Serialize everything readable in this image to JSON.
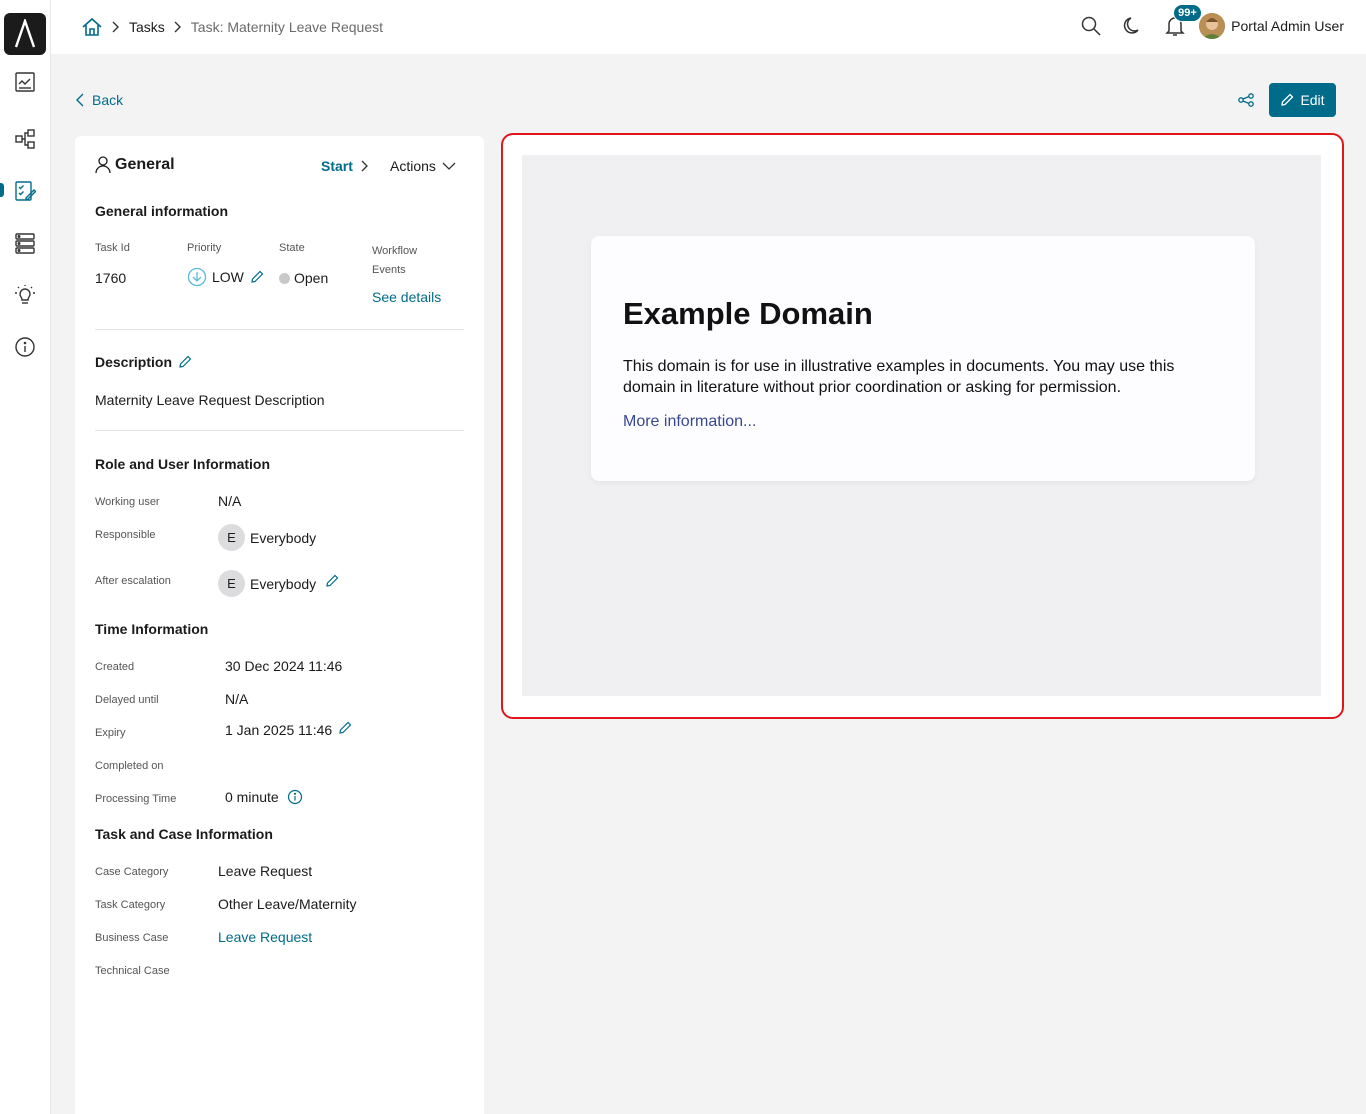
{
  "breadcrumb": {
    "items": [
      "Tasks",
      "Task: Maternity Leave Request"
    ]
  },
  "header": {
    "notification_count": "99+",
    "user_name": "Portal Admin User"
  },
  "toolbar": {
    "back_label": "Back",
    "edit_label": "Edit"
  },
  "general": {
    "title": "General",
    "start_label": "Start",
    "actions_label": "Actions",
    "info_title": "General information",
    "task_id_label": "Task Id",
    "task_id": "1760",
    "priority_label": "Priority",
    "priority": "LOW",
    "state_label": "State",
    "state": "Open",
    "workflow_label": "Workflow Events",
    "see_details": "See details"
  },
  "description": {
    "title": "Description",
    "text": "Maternity Leave Request Description"
  },
  "roles": {
    "title": "Role and User Information",
    "working_user_label": "Working user",
    "working_user": "N/A",
    "responsible_label": "Responsible",
    "responsible_initial": "E",
    "responsible": "Everybody",
    "after_escalation_label": "After escalation",
    "after_escalation_initial": "E",
    "after_escalation": "Everybody"
  },
  "time": {
    "title": "Time Information",
    "created_label": "Created",
    "created": "30 Dec 2024 11:46",
    "delayed_label": "Delayed until",
    "delayed": "N/A",
    "expiry_label": "Expiry",
    "expiry": "1 Jan 2025 11:46",
    "completed_label": "Completed on",
    "processing_label": "Processing Time",
    "processing": "0 minute"
  },
  "case": {
    "title": "Task and Case Information",
    "case_category_label": "Case Category",
    "case_category": "Leave Request",
    "task_category_label": "Task Category",
    "task_category": "Other Leave/Maternity",
    "business_case_label": "Business Case",
    "business_case": "Leave Request",
    "technical_case_label": "Technical Case"
  },
  "embedded": {
    "title": "Example Domain",
    "text": "This domain is for use in illustrative examples in documents. You may use this domain in literature without prior coordination or asking for permission.",
    "link": "More information..."
  },
  "colors": {
    "accent": "#006c8a",
    "highlight_border": "#e0161b"
  }
}
